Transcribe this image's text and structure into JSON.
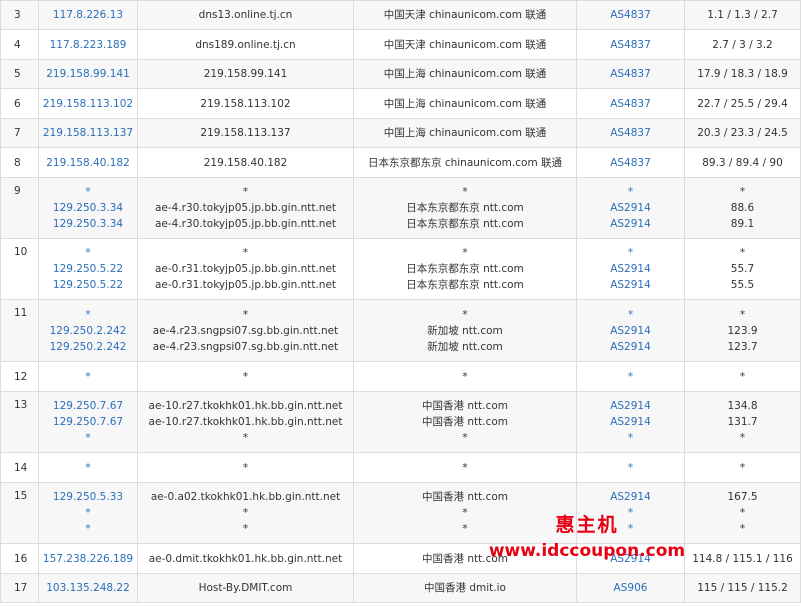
{
  "rows": [
    {
      "hop": "3",
      "ips": [
        "117.8.226.13"
      ],
      "hosts": [
        "dns13.online.tj.cn"
      ],
      "locs": [
        "中国天津 chinaunicom.com 联通"
      ],
      "asns": [
        "AS4837"
      ],
      "rtts": [
        "1.1 / 1.3 / 2.7"
      ]
    },
    {
      "hop": "4",
      "ips": [
        "117.8.223.189"
      ],
      "hosts": [
        "dns189.online.tj.cn"
      ],
      "locs": [
        "中国天津 chinaunicom.com 联通"
      ],
      "asns": [
        "AS4837"
      ],
      "rtts": [
        "2.7 / 3 / 3.2"
      ]
    },
    {
      "hop": "5",
      "ips": [
        "219.158.99.141"
      ],
      "hosts": [
        "219.158.99.141"
      ],
      "locs": [
        "中国上海 chinaunicom.com 联通"
      ],
      "asns": [
        "AS4837"
      ],
      "rtts": [
        "17.9 / 18.3 / 18.9"
      ]
    },
    {
      "hop": "6",
      "ips": [
        "219.158.113.102"
      ],
      "hosts": [
        "219.158.113.102"
      ],
      "locs": [
        "中国上海 chinaunicom.com 联通"
      ],
      "asns": [
        "AS4837"
      ],
      "rtts": [
        "22.7 / 25.5 / 29.4"
      ]
    },
    {
      "hop": "7",
      "ips": [
        "219.158.113.137"
      ],
      "hosts": [
        "219.158.113.137"
      ],
      "locs": [
        "中国上海 chinaunicom.com 联通"
      ],
      "asns": [
        "AS4837"
      ],
      "rtts": [
        "20.3 / 23.3 / 24.5"
      ]
    },
    {
      "hop": "8",
      "ips": [
        "219.158.40.182"
      ],
      "hosts": [
        "219.158.40.182"
      ],
      "locs": [
        "日本东京都东京 chinaunicom.com 联通"
      ],
      "asns": [
        "AS4837"
      ],
      "rtts": [
        "89.3 / 89.4 / 90"
      ]
    },
    {
      "hop": "9",
      "ips": [
        "*",
        "129.250.3.34",
        "129.250.3.34"
      ],
      "hosts": [
        "*",
        "ae-4.r30.tokyjp05.jp.bb.gin.ntt.net",
        "ae-4.r30.tokyjp05.jp.bb.gin.ntt.net"
      ],
      "locs": [
        "*",
        "日本东京都东京 ntt.com",
        "日本东京都东京 ntt.com"
      ],
      "asns": [
        "*",
        "AS2914",
        "AS2914"
      ],
      "rtts": [
        "*",
        "88.6",
        "89.1"
      ]
    },
    {
      "hop": "10",
      "ips": [
        "*",
        "129.250.5.22",
        "129.250.5.22"
      ],
      "hosts": [
        "*",
        "ae-0.r31.tokyjp05.jp.bb.gin.ntt.net",
        "ae-0.r31.tokyjp05.jp.bb.gin.ntt.net"
      ],
      "locs": [
        "*",
        "日本东京都东京 ntt.com",
        "日本东京都东京 ntt.com"
      ],
      "asns": [
        "*",
        "AS2914",
        "AS2914"
      ],
      "rtts": [
        "*",
        "55.7",
        "55.5"
      ]
    },
    {
      "hop": "11",
      "ips": [
        "*",
        "129.250.2.242",
        "129.250.2.242"
      ],
      "hosts": [
        "*",
        "ae-4.r23.sngpsi07.sg.bb.gin.ntt.net",
        "ae-4.r23.sngpsi07.sg.bb.gin.ntt.net"
      ],
      "locs": [
        "*",
        "新加坡 ntt.com",
        "新加坡 ntt.com"
      ],
      "asns": [
        "*",
        "AS2914",
        "AS2914"
      ],
      "rtts": [
        "*",
        "123.9",
        "123.7"
      ]
    },
    {
      "hop": "12",
      "ips": [
        "*"
      ],
      "hosts": [
        "*"
      ],
      "locs": [
        "*"
      ],
      "asns": [
        "*"
      ],
      "rtts": [
        "*"
      ]
    },
    {
      "hop": "13",
      "ips": [
        "129.250.7.67",
        "129.250.7.67",
        "*"
      ],
      "hosts": [
        "ae-10.r27.tkokhk01.hk.bb.gin.ntt.net",
        "ae-10.r27.tkokhk01.hk.bb.gin.ntt.net",
        "*"
      ],
      "locs": [
        "中国香港 ntt.com",
        "中国香港 ntt.com",
        "*"
      ],
      "asns": [
        "AS2914",
        "AS2914",
        "*"
      ],
      "rtts": [
        "134.8",
        "131.7",
        "*"
      ]
    },
    {
      "hop": "14",
      "ips": [
        "*"
      ],
      "hosts": [
        "*"
      ],
      "locs": [
        "*"
      ],
      "asns": [
        "*"
      ],
      "rtts": [
        "*"
      ]
    },
    {
      "hop": "15",
      "ips": [
        "129.250.5.33",
        "*",
        "*"
      ],
      "hosts": [
        "ae-0.a02.tkokhk01.hk.bb.gin.ntt.net",
        "*",
        "*"
      ],
      "locs": [
        "中国香港 ntt.com",
        "*",
        "*"
      ],
      "asns": [
        "AS2914",
        "*",
        "*"
      ],
      "rtts": [
        "167.5",
        "*",
        "*"
      ]
    },
    {
      "hop": "16",
      "ips": [
        "157.238.226.189"
      ],
      "hosts": [
        "ae-0.dmit.tkokhk01.hk.bb.gin.ntt.net"
      ],
      "locs": [
        "中国香港 ntt.com"
      ],
      "asns": [
        "AS2914"
      ],
      "rtts": [
        "114.8 / 115.1 / 116"
      ]
    },
    {
      "hop": "17",
      "ips": [
        "103.135.248.22"
      ],
      "hosts": [
        "Host-By.DMIT.com"
      ],
      "locs": [
        "中国香港 dmit.io"
      ],
      "asns": [
        "AS906"
      ],
      "rtts": [
        "115 / 115 / 115.2"
      ]
    }
  ],
  "watermark": {
    "line1": "惠主机",
    "line2": "www.idccoupon.com",
    "color": "#e60012"
  },
  "colors": {
    "link": "#2a6ebb",
    "text": "#333333",
    "border": "#dcdcdc",
    "stripe": "#f7f7f7"
  }
}
